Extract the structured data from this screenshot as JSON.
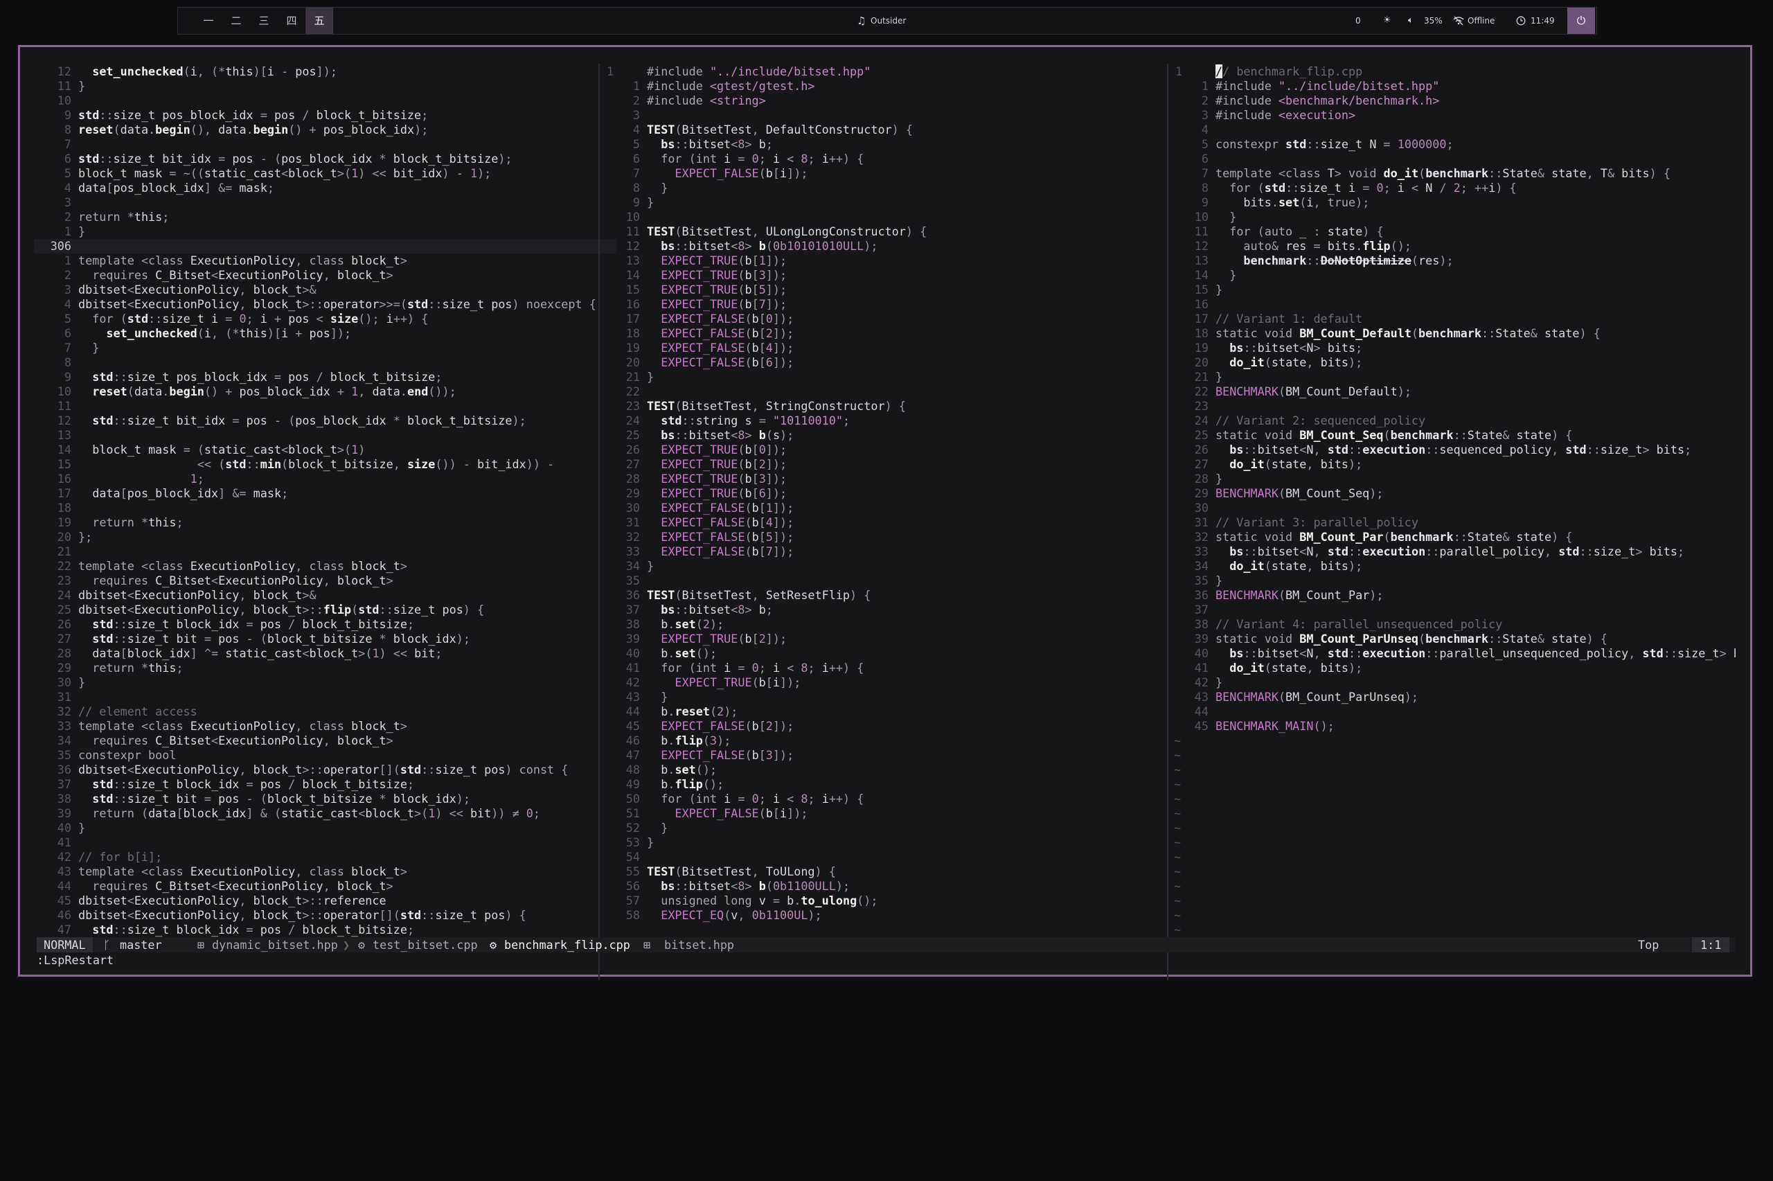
{
  "topbar": {
    "workspaces": [
      "一",
      "二",
      "三",
      "四",
      "五"
    ],
    "active_workspace": 4,
    "music_icon": "music-note-icon",
    "now_playing": "Outsider",
    "notif_count": "0",
    "volume": "35%",
    "network": "Offline",
    "clock": "11:49"
  },
  "pane_left": {
    "lines": [
      [
        "12",
        "  set_unchecked(i, (*this)[i - pos]);"
      ],
      [
        "11",
        "}"
      ],
      [
        "10",
        ""
      ],
      [
        "9",
        "std::size_t pos_block_idx = pos / block_t_bitsize;"
      ],
      [
        "8",
        "reset(data.begin(), data.begin() + pos_block_idx);"
      ],
      [
        "7",
        ""
      ],
      [
        "6",
        "std::size_t bit_idx = pos - (pos_block_idx * block_t_bitsize);"
      ],
      [
        "5",
        "block_t mask = ~((static_cast<block_t>(1) << bit_idx) - 1);"
      ],
      [
        "4",
        "data[pos_block_idx] &= mask;"
      ],
      [
        "3",
        ""
      ],
      [
        "2",
        "return *this;"
      ],
      [
        "1",
        "}"
      ],
      [
        "306",
        ""
      ],
      [
        "1",
        "template <class ExecutionPolicy, class block_t>"
      ],
      [
        "2",
        "  requires C_Bitset<ExecutionPolicy, block_t>"
      ],
      [
        "3",
        "dbitset<ExecutionPolicy, block_t>&"
      ],
      [
        "4",
        "dbitset<ExecutionPolicy, block_t>::operator>>=(std::size_t pos) noexcept {"
      ],
      [
        "5",
        "  for (std::size_t i = 0; i + pos < size(); i++) {"
      ],
      [
        "6",
        "    set_unchecked(i, (*this)[i + pos]);"
      ],
      [
        "7",
        "  }"
      ],
      [
        "8",
        ""
      ],
      [
        "9",
        "  std::size_t pos_block_idx = pos / block_t_bitsize;"
      ],
      [
        "10",
        "  reset(data.begin() + pos_block_idx + 1, data.end());"
      ],
      [
        "11",
        ""
      ],
      [
        "12",
        "  std::size_t bit_idx = pos - (pos_block_idx * block_t_bitsize);"
      ],
      [
        "13",
        ""
      ],
      [
        "14",
        "  block_t mask = (static_cast<block_t>(1)"
      ],
      [
        "15",
        "                 << (std::min(block_t_bitsize, size()) - bit_idx)) -"
      ],
      [
        "16",
        "                1;"
      ],
      [
        "17",
        "  data[pos_block_idx] &= mask;"
      ],
      [
        "18",
        ""
      ],
      [
        "19",
        "  return *this;"
      ],
      [
        "20",
        "};"
      ],
      [
        "21",
        ""
      ],
      [
        "22",
        "template <class ExecutionPolicy, class block_t>"
      ],
      [
        "23",
        "  requires C_Bitset<ExecutionPolicy, block_t>"
      ],
      [
        "24",
        "dbitset<ExecutionPolicy, block_t>&"
      ],
      [
        "25",
        "dbitset<ExecutionPolicy, block_t>::flip(std::size_t pos) {"
      ],
      [
        "26",
        "  std::size_t block_idx = pos / block_t_bitsize;"
      ],
      [
        "27",
        "  std::size_t bit = pos - (block_t_bitsize * block_idx);"
      ],
      [
        "28",
        "  data[block_idx] ^= static_cast<block_t>(1) << bit;"
      ],
      [
        "29",
        "  return *this;"
      ],
      [
        "30",
        "}"
      ],
      [
        "31",
        ""
      ],
      [
        "32",
        "// element access"
      ],
      [
        "33",
        "template <class ExecutionPolicy, class block_t>"
      ],
      [
        "34",
        "  requires C_Bitset<ExecutionPolicy, block_t>"
      ],
      [
        "35",
        "constexpr bool"
      ],
      [
        "36",
        "dbitset<ExecutionPolicy, block_t>::operator[](std::size_t pos) const {"
      ],
      [
        "37",
        "  std::size_t block_idx = pos / block_t_bitsize;"
      ],
      [
        "38",
        "  std::size_t bit = pos - (block_t_bitsize * block_idx);"
      ],
      [
        "39",
        "  return (data[block_idx] & (static_cast<block_t>(1) << bit)) ≠ 0;"
      ],
      [
        "40",
        "}"
      ],
      [
        "41",
        ""
      ],
      [
        "42",
        "// for b[i];"
      ],
      [
        "43",
        "template <class ExecutionPolicy, class block_t>"
      ],
      [
        "44",
        "  requires C_Bitset<ExecutionPolicy, block_t>"
      ],
      [
        "45",
        "dbitset<ExecutionPolicy, block_t>::reference"
      ],
      [
        "46",
        "dbitset<ExecutionPolicy, block_t>::operator[](std::size_t pos) {"
      ],
      [
        "47",
        "  std::size_t block_idx = pos / block_t_bitsize;"
      ]
    ]
  },
  "pane_mid": {
    "lines": [
      [
        "1",
        "#include \"../include/bitset.hpp\""
      ],
      [
        "1",
        "#include <gtest/gtest.h>"
      ],
      [
        "2",
        "#include <string>"
      ],
      [
        "3",
        ""
      ],
      [
        "4",
        "TEST(BitsetTest, DefaultConstructor) {"
      ],
      [
        "5",
        "  bs::bitset<8> b;"
      ],
      [
        "6",
        "  for (int i = 0; i < 8; i++) {"
      ],
      [
        "7",
        "    EXPECT_FALSE(b[i]);"
      ],
      [
        "8",
        "  }"
      ],
      [
        "9",
        "}"
      ],
      [
        "10",
        ""
      ],
      [
        "11",
        "TEST(BitsetTest, ULongLongConstructor) {"
      ],
      [
        "12",
        "  bs::bitset<8> b(0b10101010ULL);"
      ],
      [
        "13",
        "  EXPECT_TRUE(b[1]);"
      ],
      [
        "14",
        "  EXPECT_TRUE(b[3]);"
      ],
      [
        "15",
        "  EXPECT_TRUE(b[5]);"
      ],
      [
        "16",
        "  EXPECT_TRUE(b[7]);"
      ],
      [
        "17",
        "  EXPECT_FALSE(b[0]);"
      ],
      [
        "18",
        "  EXPECT_FALSE(b[2]);"
      ],
      [
        "19",
        "  EXPECT_FALSE(b[4]);"
      ],
      [
        "20",
        "  EXPECT_FALSE(b[6]);"
      ],
      [
        "21",
        "}"
      ],
      [
        "22",
        ""
      ],
      [
        "23",
        "TEST(BitsetTest, StringConstructor) {"
      ],
      [
        "24",
        "  std::string s = \"10110010\";"
      ],
      [
        "25",
        "  bs::bitset<8> b(s);"
      ],
      [
        "26",
        "  EXPECT_TRUE(b[0]);"
      ],
      [
        "27",
        "  EXPECT_TRUE(b[2]);"
      ],
      [
        "28",
        "  EXPECT_TRUE(b[3]);"
      ],
      [
        "29",
        "  EXPECT_TRUE(b[6]);"
      ],
      [
        "30",
        "  EXPECT_FALSE(b[1]);"
      ],
      [
        "31",
        "  EXPECT_FALSE(b[4]);"
      ],
      [
        "32",
        "  EXPECT_FALSE(b[5]);"
      ],
      [
        "33",
        "  EXPECT_FALSE(b[7]);"
      ],
      [
        "34",
        "}"
      ],
      [
        "35",
        ""
      ],
      [
        "36",
        "TEST(BitsetTest, SetResetFlip) {"
      ],
      [
        "37",
        "  bs::bitset<8> b;"
      ],
      [
        "38",
        "  b.set(2);"
      ],
      [
        "39",
        "  EXPECT_TRUE(b[2]);"
      ],
      [
        "40",
        "  b.set();"
      ],
      [
        "41",
        "  for (int i = 0; i < 8; i++) {"
      ],
      [
        "42",
        "    EXPECT_TRUE(b[i]);"
      ],
      [
        "43",
        "  }"
      ],
      [
        "44",
        "  b.reset(2);"
      ],
      [
        "45",
        "  EXPECT_FALSE(b[2]);"
      ],
      [
        "46",
        "  b.flip(3);"
      ],
      [
        "47",
        "  EXPECT_FALSE(b[3]);"
      ],
      [
        "48",
        "  b.set();"
      ],
      [
        "49",
        "  b.flip();"
      ],
      [
        "50",
        "  for (int i = 0; i < 8; i++) {"
      ],
      [
        "51",
        "    EXPECT_FALSE(b[i]);"
      ],
      [
        "52",
        "  }"
      ],
      [
        "53",
        "}"
      ],
      [
        "54",
        ""
      ],
      [
        "55",
        "TEST(BitsetTest, ToULong) {"
      ],
      [
        "56",
        "  bs::bitset<8> b(0b1100ULL);"
      ],
      [
        "57",
        "  unsigned long v = b.to_ulong();"
      ],
      [
        "58",
        "  EXPECT_EQ(v, 0b1100UL);"
      ]
    ]
  },
  "pane_right": {
    "lines": [
      [
        "1",
        "// benchmark_flip.cpp"
      ],
      [
        "1",
        "#include \"../include/bitset.hpp\""
      ],
      [
        "2",
        "#include <benchmark/benchmark.h>"
      ],
      [
        "3",
        "#include <execution>"
      ],
      [
        "4",
        ""
      ],
      [
        "5",
        "constexpr std::size_t N = 1000000;"
      ],
      [
        "6",
        ""
      ],
      [
        "7",
        "template <class T> void do_it(benchmark::State& state, T& bits) {"
      ],
      [
        "8",
        "  for (std::size_t i = 0; i < N / 2; ++i) {"
      ],
      [
        "9",
        "    bits.set(i, true);"
      ],
      [
        "10",
        "  }"
      ],
      [
        "11",
        "  for (auto _ : state) {"
      ],
      [
        "12",
        "    auto& res = bits.flip();"
      ],
      [
        "13",
        "    benchmark::DoNotOptimize(res);"
      ],
      [
        "14",
        "  }"
      ],
      [
        "15",
        "}"
      ],
      [
        "16",
        ""
      ],
      [
        "17",
        "// Variant 1: default"
      ],
      [
        "18",
        "static void BM_Count_Default(benchmark::State& state) {"
      ],
      [
        "19",
        "  bs::bitset<N> bits;"
      ],
      [
        "20",
        "  do_it(state, bits);"
      ],
      [
        "21",
        "}"
      ],
      [
        "22",
        "BENCHMARK(BM_Count_Default);"
      ],
      [
        "23",
        ""
      ],
      [
        "24",
        "// Variant 2: sequenced_policy"
      ],
      [
        "25",
        "static void BM_Count_Seq(benchmark::State& state) {"
      ],
      [
        "26",
        "  bs::bitset<N, std::execution::sequenced_policy, std::size_t> bits;"
      ],
      [
        "27",
        "  do_it(state, bits);"
      ],
      [
        "28",
        "}"
      ],
      [
        "29",
        "BENCHMARK(BM_Count_Seq);"
      ],
      [
        "30",
        ""
      ],
      [
        "31",
        "// Variant 3: parallel_policy"
      ],
      [
        "32",
        "static void BM_Count_Par(benchmark::State& state) {"
      ],
      [
        "33",
        "  bs::bitset<N, std::execution::parallel_policy, std::size_t> bits;"
      ],
      [
        "34",
        "  do_it(state, bits);"
      ],
      [
        "35",
        "}"
      ],
      [
        "36",
        "BENCHMARK(BM_Count_Par);"
      ],
      [
        "37",
        ""
      ],
      [
        "38",
        "// Variant 4: parallel_unsequenced_policy"
      ],
      [
        "39",
        "static void BM_Count_ParUnseq(benchmark::State& state) {"
      ],
      [
        "40",
        "  bs::bitset<N, std::execution::parallel_unsequenced_policy, std::size_t> bi"
      ],
      [
        "41",
        "  do_it(state, bits);"
      ],
      [
        "42",
        "}"
      ],
      [
        "43",
        "BENCHMARK(BM_Count_ParUnseq);"
      ],
      [
        "44",
        ""
      ],
      [
        "45",
        "BENCHMARK_MAIN();"
      ]
    ],
    "eob_marker": "~"
  },
  "statusline": {
    "mode": "NORMAL",
    "branch_icon": "git-branch-icon",
    "branch": "master",
    "buffers": [
      "dynamic_bitset.hpp",
      "test_bitset.cpp",
      "benchmark_flip.cpp",
      "bitset.hpp"
    ],
    "active_buffer": 2,
    "position": "Top",
    "cursor": "1:1"
  },
  "cmdline": ":LspRestart",
  "colors": {
    "border": "#93649b",
    "accent": "#6e5378",
    "background": "#161618"
  }
}
